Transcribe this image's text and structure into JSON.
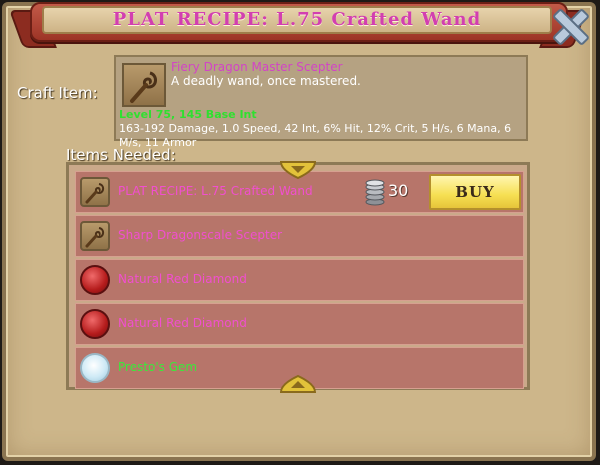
{
  "banner": {
    "title": "PLAT RECIPE: L.75 Crafted Wand"
  },
  "craft": {
    "label": "Craft Item:",
    "item_name": "Fiery Dragon Master Scepter",
    "item_desc": "A deadly wand, once mastered.",
    "level_line": "Level 75, 145 Base Int",
    "stats": "163-192 Damage, 1.0 Speed, 42 Int, 6% Hit, 12% Crit, 5 H/s, 6 Mana, 6 M/s, 11 Armor"
  },
  "needed": {
    "label": "Items Needed:",
    "items": [
      {
        "name": "PLAT RECIPE: L.75 Crafted Wand",
        "icon": "scepter-icon",
        "price": "30",
        "buy_label": "BUY",
        "color": "#f14fcf"
      },
      {
        "name": "Sharp Dragonscale Scepter",
        "icon": "scepter-icon",
        "color": "#f14fcf"
      },
      {
        "name": "Natural Red Diamond",
        "icon": "red-diamond-icon",
        "color": "#f14fcf"
      },
      {
        "name": "Natural Red Diamond",
        "icon": "red-diamond-icon",
        "color": "#f14fcf"
      },
      {
        "name": "Presto's Gem",
        "icon": "white-gem-icon",
        "color": "#3aea3a"
      }
    ]
  },
  "colors": {
    "banner": "#b14232",
    "panel": "#cdb68a",
    "row": "#b7756a",
    "buy": "#f6df52",
    "item_pink": "#f14fcf",
    "item_green": "#3aea3a"
  }
}
